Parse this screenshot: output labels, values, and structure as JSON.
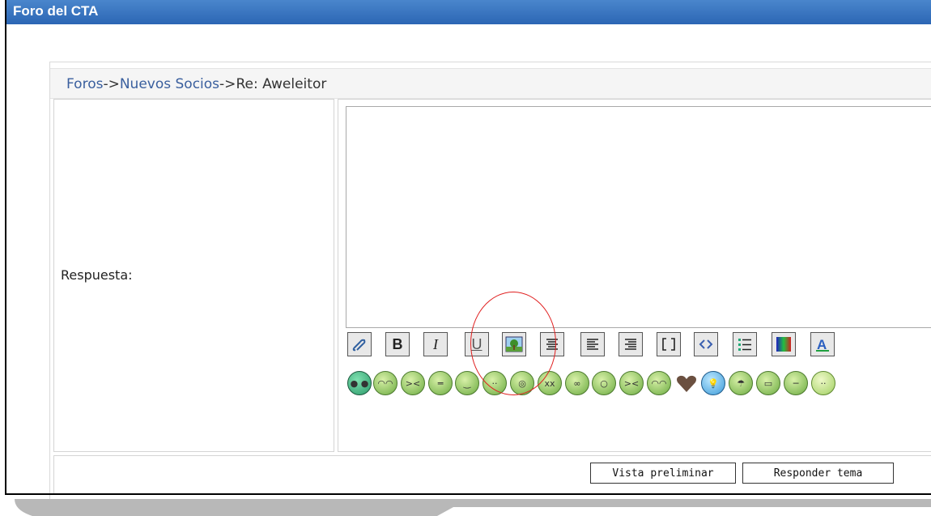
{
  "window": {
    "title": "Foro del CTA"
  },
  "breadcrumb": {
    "foros": "Foros",
    "sep1": "->",
    "section": "Nuevos Socios",
    "sep2": "->",
    "current": "Re: Aweleitor"
  },
  "form": {
    "reply_label": "Respuesta:",
    "textarea_value": ""
  },
  "toolbar": [
    "link-icon",
    "bold-icon",
    "italic-icon",
    "underline-icon",
    "image-icon",
    "align-center-icon",
    "align-left-icon",
    "align-right-icon",
    "brackets-icon",
    "code-icon",
    "list-icon",
    "color-icon",
    "font-icon"
  ],
  "smileys": [
    "alien-icon",
    "laugh-icon",
    "sad-icon",
    "grin-icon",
    "smile-icon",
    "smile-icon",
    "eek-icon",
    "dead-icon",
    "cool-icon",
    "shock-icon",
    "mad-icon",
    "happy-icon",
    "heart-icon",
    "idea-icon",
    "wink-icon",
    "angry-icon",
    "neutral-icon",
    "smile-icon"
  ],
  "buttons": {
    "preview": "Vista preliminar",
    "reply": "Responder tema"
  },
  "colors": {
    "titlebar": "#2c66b4",
    "link": "#3a5f9e",
    "annotation": "#e02020"
  }
}
